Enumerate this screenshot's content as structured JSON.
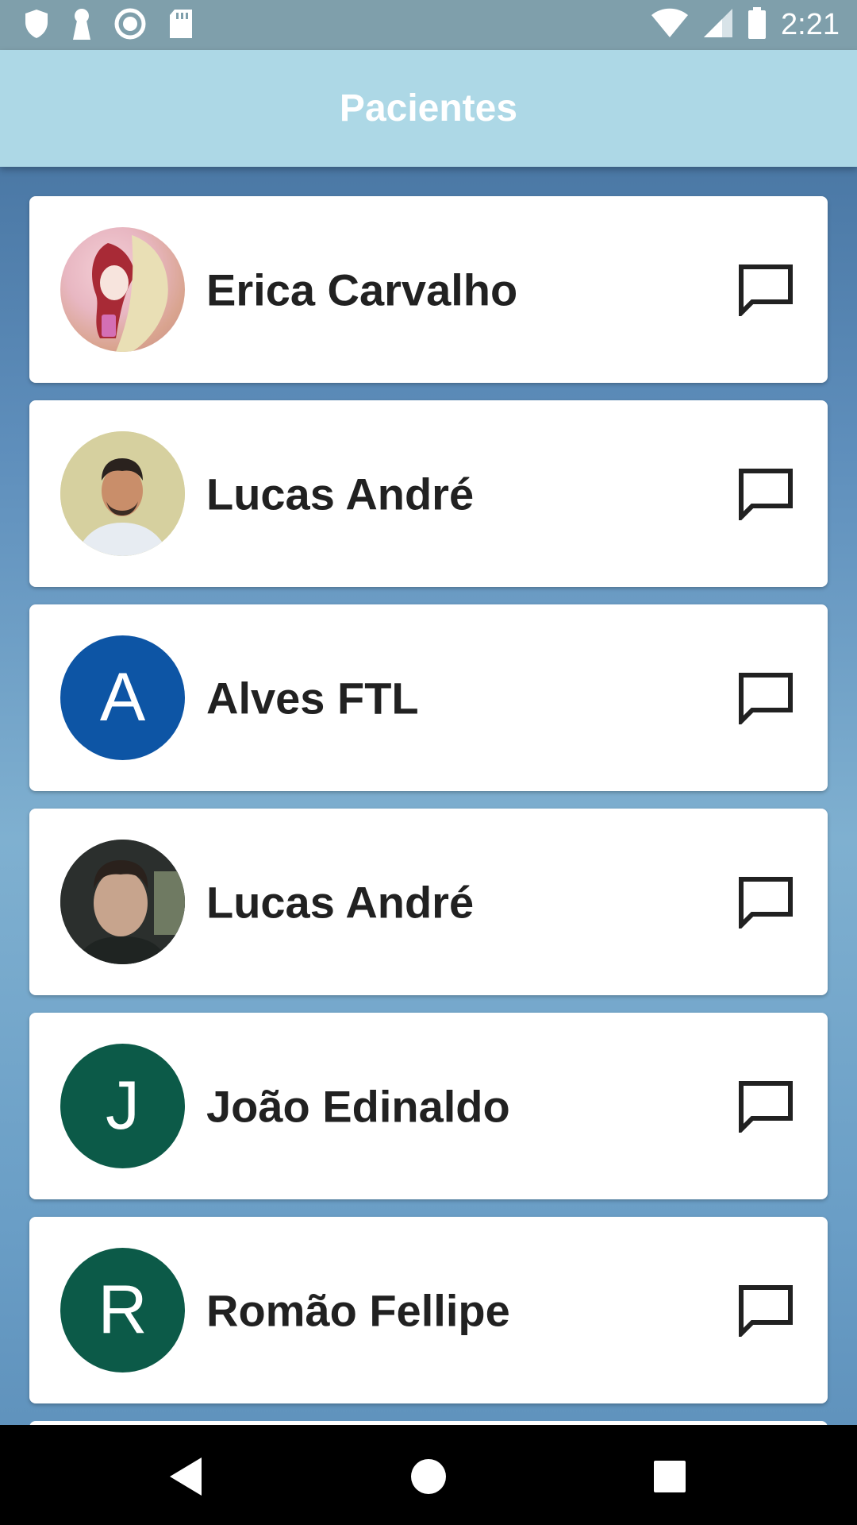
{
  "status_bar": {
    "time": "2:21",
    "left_icons": [
      "shield-icon",
      "keyhole-icon",
      "record-icon",
      "sd-card-icon"
    ],
    "right_icons": [
      "wifi-icon",
      "signal-icon",
      "battery-icon"
    ]
  },
  "app_bar": {
    "title": "Pacientes",
    "color": "#add8e6"
  },
  "patients": [
    {
      "name": "Erica Carvalho",
      "avatar_type": "photo",
      "avatar_letter": ""
    },
    {
      "name": "Lucas André",
      "avatar_type": "photo",
      "avatar_letter": ""
    },
    {
      "name": "Alves FTL",
      "avatar_type": "letter",
      "avatar_letter": "A",
      "avatar_color": "#0d55a5"
    },
    {
      "name": "Lucas André",
      "avatar_type": "photo",
      "avatar_letter": ""
    },
    {
      "name": "João Edinaldo",
      "avatar_type": "letter",
      "avatar_letter": "J",
      "avatar_color": "#0c5a48"
    },
    {
      "name": "Romão Fellipe",
      "avatar_type": "letter",
      "avatar_letter": "R",
      "avatar_color": "#0c5a48"
    }
  ],
  "row_action_icon": "chat-bubble-icon",
  "nav_bar": {
    "buttons": [
      "back-icon",
      "home-icon",
      "recents-icon"
    ]
  }
}
